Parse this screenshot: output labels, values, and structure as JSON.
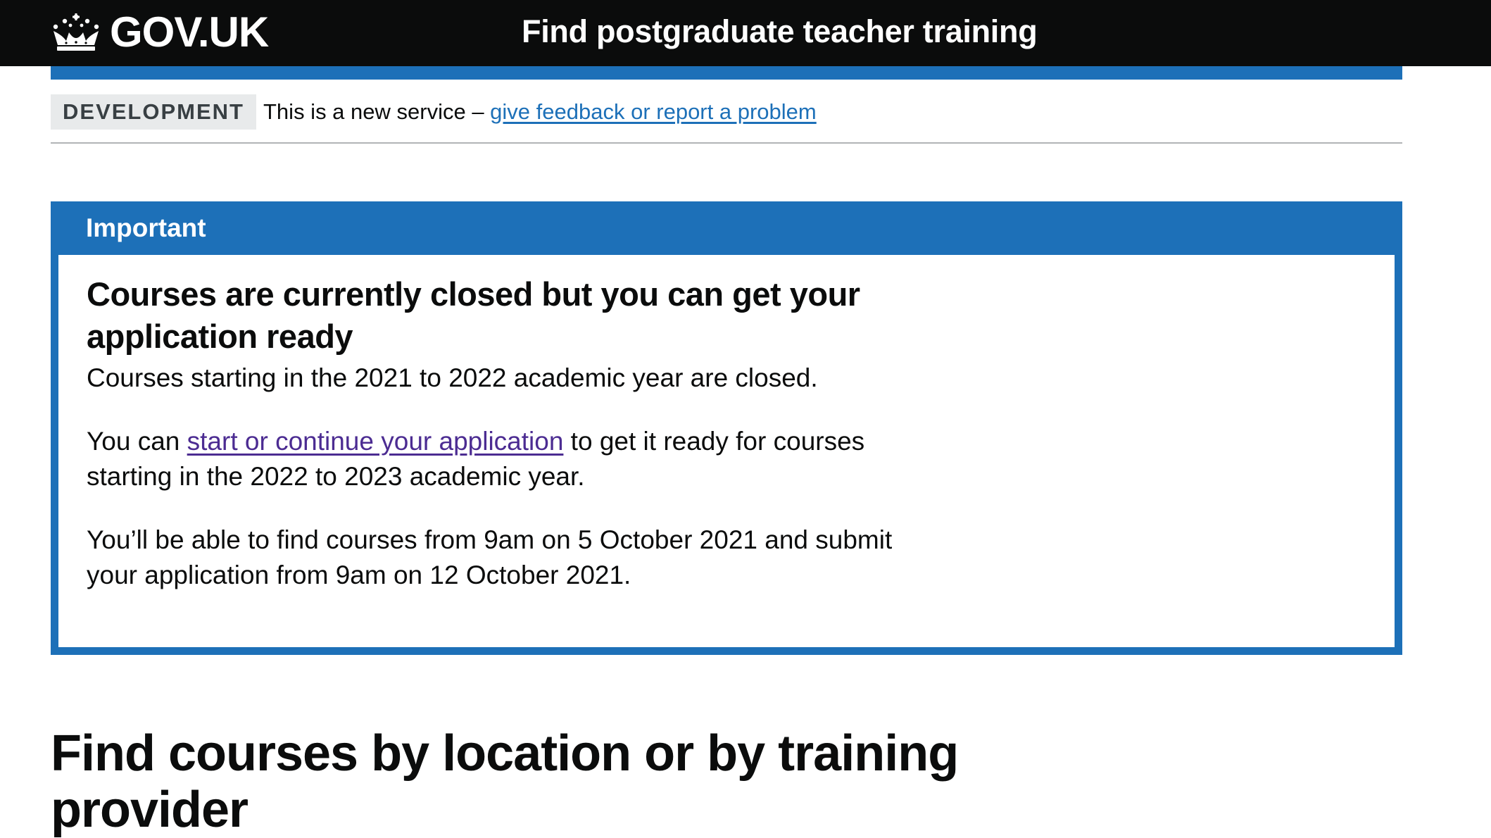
{
  "header": {
    "logo_text": "GOV.UK",
    "service_name": "Find postgraduate teacher training",
    "logo_icon": "crown-icon",
    "background_color": "#0b0c0c",
    "underline_color": "#1d70b8"
  },
  "phase_banner": {
    "tag": "DEVELOPMENT",
    "text": "This is a new service – ",
    "link_text": "give feedback or report a problem"
  },
  "notification": {
    "title": "Important",
    "heading": "Courses are currently closed but you can get your application ready",
    "paragraph1": "Courses starting in the 2021 to 2022 academic year are closed.",
    "paragraph2_before": "You can ",
    "paragraph2_link": "start or continue your application",
    "paragraph2_after": " to get it ready for courses starting in the 2022 to 2023 academic year.",
    "paragraph3": "You’ll be able to find courses from 9am on 5 October 2021 and submit your application from 9am on 12 October 2021.",
    "border_color": "#1d70b8"
  },
  "main": {
    "heading": "Find courses by location or by training provider"
  },
  "colors": {
    "link": "#1d70b8",
    "visited_link": "#4c2c92",
    "text": "#0b0c0c"
  }
}
